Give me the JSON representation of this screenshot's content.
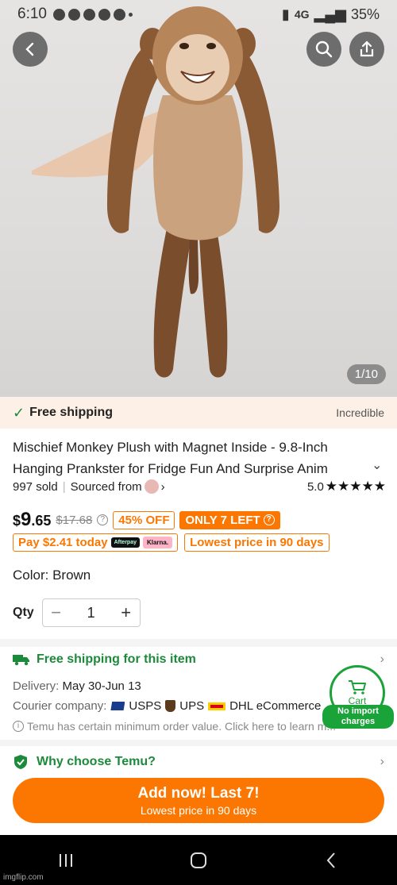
{
  "status_bar": {
    "time": "6:10",
    "network": "4G",
    "battery": "35%"
  },
  "hero": {
    "image_counter": "1/10"
  },
  "shipping_bar": {
    "label": "Free shipping",
    "tag": "Incredible"
  },
  "product": {
    "title": "Mischief Monkey Plush with Magnet Inside - 9.8-Inch Hanging Prankster for Fridge Fun And Surprise Anim",
    "sold": "997 sold",
    "sourced_from": "Sourced from",
    "rating": "5.0",
    "stars": "★★★★★",
    "price_currency": "$",
    "price_whole": "9",
    "price_cents": ".65",
    "old_price": "$17.68",
    "discount": "45% OFF",
    "stock_left": "ONLY 7 LEFT",
    "pay_installment": "Pay $2.41 today",
    "afterpay_label": "Afterpay",
    "klarna_label": "Klarna.",
    "lowest_price": "Lowest price in 90 days",
    "color_label": "Color: Brown",
    "qty_label": "Qty",
    "qty_value": "1"
  },
  "shipping_details": {
    "headline": "Free shipping for this item",
    "delivery_key": "Delivery:",
    "delivery_value": "May 30-Jun 13",
    "courier_key": "Courier company:",
    "courier_usps": "USPS",
    "courier_ups": "UPS",
    "courier_dhl": "DHL eCommerce",
    "min_order_note": "Temu has certain minimum order value. Click here to learn m..."
  },
  "cart_float": {
    "label": "Cart",
    "badge": "No import charges"
  },
  "why_choose": {
    "label": "Why choose Temu?"
  },
  "cta": {
    "main": "Add now! Last 7!",
    "sub": "Lowest price in 90 days"
  },
  "watermark": "imgflip.com",
  "colors": {
    "brand_orange": "#fb7701",
    "brand_green": "#1c8a3a",
    "shipping_bar_bg": "#fdf0e6"
  }
}
